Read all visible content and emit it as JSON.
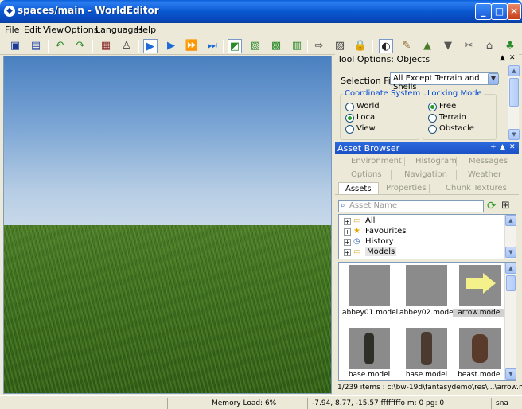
{
  "window": {
    "title": "spaces/main - WorldEditor",
    "minimize": "_",
    "maximize": "□",
    "close": "✕"
  },
  "menu": [
    "File",
    "Edit",
    "View",
    "Options",
    "Languages",
    "Help"
  ],
  "tool_options": {
    "title": "Tool Options: Objects",
    "selection_filter_label": "Selection Filter",
    "selection_filter_value": "All Except Terrain and Shells",
    "coordinate_system": {
      "label": "Coordinate System",
      "options": [
        "World",
        "Local",
        "View"
      ],
      "selected": "Local"
    },
    "locking_mode": {
      "label": "Locking Mode",
      "options": [
        "Free",
        "Terrain",
        "Obstacle"
      ],
      "selected": "Free"
    }
  },
  "asset_browser": {
    "title": "Asset Browser",
    "tabs_row1": [
      "Environment",
      "Histogram",
      "Messages"
    ],
    "tabs_row2": [
      "Options",
      "Navigation",
      "Weather"
    ],
    "tabs_row3": [
      "Assets",
      "Properties",
      "Chunk Textures"
    ],
    "active_tab": "Assets",
    "search_placeholder": "Asset Name",
    "tree": [
      "All",
      "Favourites",
      "History",
      "Models"
    ],
    "thumbnails": [
      {
        "caption": "abbey01.model"
      },
      {
        "caption": "abbey02.model"
      },
      {
        "caption": "arrow.model"
      },
      {
        "caption": "base.model"
      },
      {
        "caption": "base.model"
      },
      {
        "caption": "beast.model"
      }
    ],
    "status": "1/239 items : c:\\bw-19d\\fantasydemo\\res\\...\\arrow.model"
  },
  "statusbar": {
    "memory": "Memory Load: 6%",
    "position": "-7.94, 8.77, -15.57 ffffffffo m: 0 pg: 0",
    "snap": "sna"
  },
  "colors": {
    "title_blue": "#0a58d0",
    "panel_bg": "#ece9d8",
    "selected_tab": "#ffffff"
  }
}
